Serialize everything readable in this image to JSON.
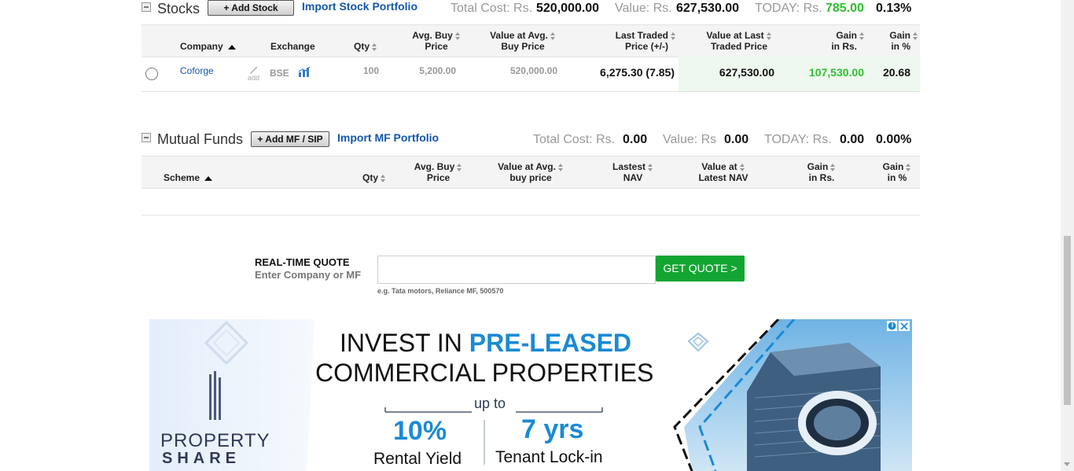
{
  "stocks": {
    "title": "Stocks",
    "add_label": "+ Add Stock",
    "import_label": "Import Stock Portfolio",
    "total_cost_label": "Total Cost: Rs.",
    "total_cost": "520,000.00",
    "value_label": "Value: Rs.",
    "value": "627,530.00",
    "today_label": "TODAY: Rs.",
    "today_value": "785.00",
    "today_pct": "0.13%",
    "headers": {
      "company": "Company",
      "exchange": "Exchange",
      "qty": "Qty",
      "avg_buy_1": "Avg. Buy",
      "avg_buy_2": "Price",
      "value_avg_1": "Value at Avg.",
      "value_avg_2": "Buy Price",
      "ltp_1": "Last Traded",
      "ltp_2": "Price (+/-)",
      "val_ltp_1": "Value at Last",
      "val_ltp_2": "Traded Price",
      "gain_1": "Gain",
      "gain_2": "in Rs.",
      "gainpct_1": "Gain",
      "gainpct_2": "in %"
    },
    "row": {
      "company": "Coforge",
      "add_note": "add",
      "exchange": "BSE",
      "qty": "100",
      "avg_buy": "5,200.00",
      "value_avg": "520,000.00",
      "ltp": "6,275.30 (7.85)",
      "val_ltp": "627,530.00",
      "gain": "107,530.00",
      "gain_pct": "20.68"
    }
  },
  "mf": {
    "title": "Mutual Funds",
    "add_label": "+ Add MF / SIP",
    "import_label": "Import MF Portfolio",
    "total_cost_label": "Total Cost: Rs.",
    "total_cost": "0.00",
    "value_label": "Value: Rs",
    "value": "0.00",
    "today_label": "TODAY: Rs.",
    "today_value": "0.00",
    "today_pct": "0.00%",
    "headers": {
      "scheme": "Scheme",
      "qty": "Qty",
      "avg_buy_1": "Avg. Buy",
      "avg_buy_2": "Price",
      "value_avg_1": "Value at Avg.",
      "value_avg_2": "buy price",
      "nav_1": "Lastest",
      "nav_2": "NAV",
      "val_nav_1": "Value at",
      "val_nav_2": "Latest NAV",
      "gain_1": "Gain",
      "gain_2": "in Rs.",
      "gainpct_1": "Gain",
      "gainpct_2": "in %"
    }
  },
  "quote": {
    "title": "REAL-TIME QUOTE",
    "subtitle": "Enter Company or MF",
    "hint": "e.g. Tata motors, Reliance MF, 500570",
    "button": "GET QUOTE >"
  },
  "ad": {
    "brand_1": "PROPERTY",
    "brand_2": "SHARE",
    "line1a": "INVEST IN ",
    "line1b": "PRE-LEASED",
    "line2": "COMMERCIAL PROPERTIES",
    "upto": "up to",
    "stat1_value": "10%",
    "stat1_label": "Rental Yield",
    "stat2_value": "7 yrs",
    "stat2_label": "Tenant Lock-in"
  },
  "colors": {
    "link": "#1257a8",
    "gain_green": "#2fbf2f",
    "quote_button": "#13a532",
    "ad_blue": "#1a8ad4"
  }
}
